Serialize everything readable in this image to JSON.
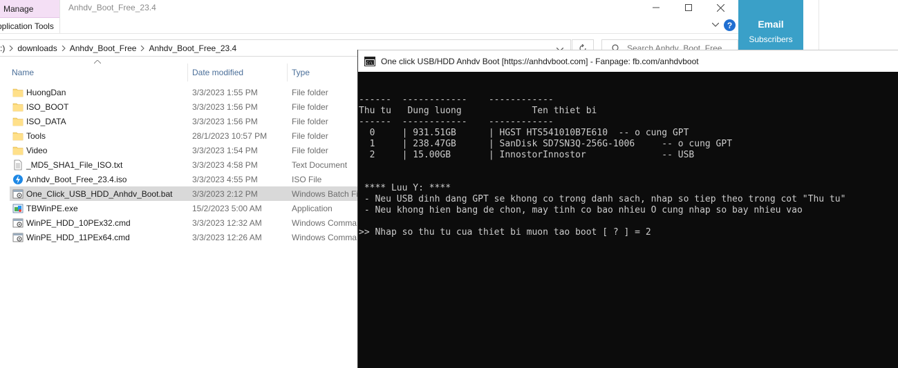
{
  "explorer": {
    "ribbon_tab": "Manage",
    "ribbon_subtab": "Application Tools",
    "window_title": "Anhdv_Boot_Free_23.4",
    "breadcrumbs": [
      ":)",
      "downloads",
      "Anhdv_Boot_Free",
      "Anhdv_Boot_Free_23.4"
    ],
    "search_placeholder": "Search Anhdv_Boot_Free...",
    "columns": {
      "name": "Name",
      "date": "Date modified",
      "type": "Type"
    },
    "files": [
      {
        "icon": "folder-icon",
        "name": "HuongDan",
        "date": "3/3/2023 1:55 PM",
        "type": "File folder"
      },
      {
        "icon": "folder-icon",
        "name": "ISO_BOOT",
        "date": "3/3/2023 1:56 PM",
        "type": "File folder"
      },
      {
        "icon": "folder-icon",
        "name": "ISO_DATA",
        "date": "3/3/2023 1:56 PM",
        "type": "File folder"
      },
      {
        "icon": "folder-icon",
        "name": "Tools",
        "date": "28/1/2023 10:57 PM",
        "type": "File folder"
      },
      {
        "icon": "folder-icon",
        "name": "Video",
        "date": "3/3/2023 1:54 PM",
        "type": "File folder"
      },
      {
        "icon": "text-file-icon",
        "name": "_MD5_SHA1_File_ISO.txt",
        "date": "3/3/2023 4:58 PM",
        "type": "Text Document"
      },
      {
        "icon": "iso-file-icon",
        "name": "Anhdv_Boot_Free_23.4.iso",
        "date": "3/3/2023 4:55 PM",
        "type": "ISO File"
      },
      {
        "icon": "batch-file-icon",
        "name": "One_Click_USB_HDD_Anhdv_Boot.bat",
        "date": "3/3/2023 2:12 PM",
        "type": "Windows Batch Fi",
        "selected": true
      },
      {
        "icon": "exe-file-icon",
        "name": "TBWinPE.exe",
        "date": "15/2/2023 5:00 AM",
        "type": "Application"
      },
      {
        "icon": "cmd-file-icon",
        "name": "WinPE_HDD_10PEx32.cmd",
        "date": "3/3/2023 12:32 AM",
        "type": "Windows Comma"
      },
      {
        "icon": "cmd-file-icon",
        "name": "WinPE_HDD_11PEx64.cmd",
        "date": "3/3/2023 12:26 AM",
        "type": "Windows Comma"
      }
    ]
  },
  "widget": {
    "title": "Email",
    "subtitle": "Subscribers"
  },
  "console": {
    "title": "One click USB/HDD Anhdv Boot [https://anhdvboot.com] -  Fanpage: fb.com/anhdvboot",
    "lines": [
      "------  ------------    ------------",
      "Thu tu   Dung luong             Ten thiet bi",
      "------  ------------    ------------",
      "  0     | 931.51GB      | HGST HTS541010B7E610  -- o cung GPT",
      "  1     | 238.47GB      | SanDisk SD7SN3Q-256G-1006     -- o cung GPT",
      "  2     | 15.00GB       | InnostorInnostor              -- USB",
      "",
      "",
      " **** Luu Y: ****",
      " - Neu USB dinh dang GPT se khong co trong danh sach, nhap so tiep theo trong cot \"Thu tu\"",
      " - Neu khong hien bang de chon, may tinh co bao nhieu O cung nhap so bay nhieu vao",
      "",
      ">> Nhap so thu tu cua thiet bi muon tao boot [ ? ] = 2"
    ]
  },
  "colors": {
    "ribbon_manage": "#f4dff5",
    "widget_bg": "#3aa0c8",
    "console_bg": "#0c0c0c",
    "console_text": "#cccccc",
    "selected_row": "#d9d9d9"
  }
}
